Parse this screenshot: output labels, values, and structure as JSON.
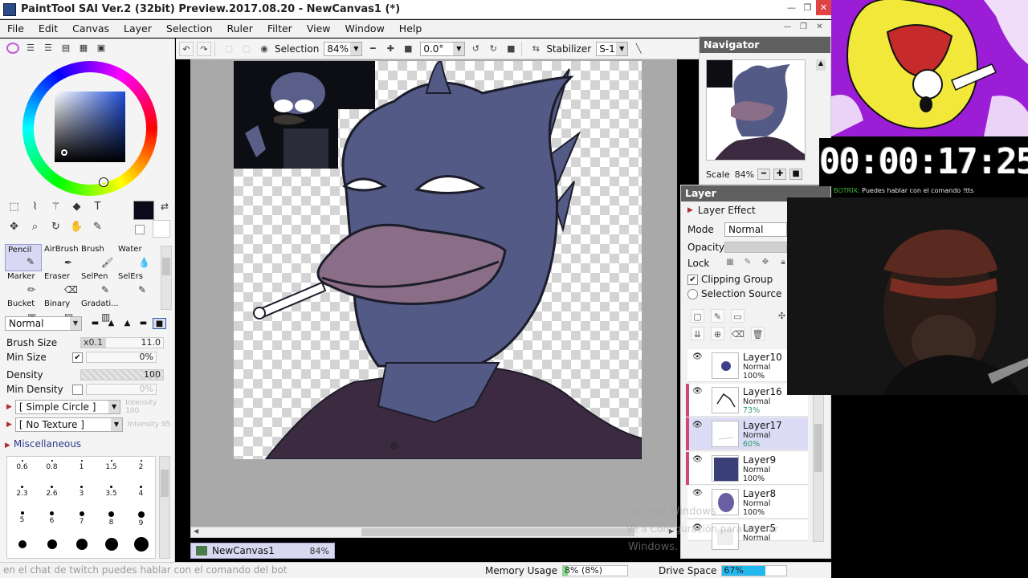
{
  "window": {
    "title": "PaintTool SAI Ver.2 (32bit) Preview.2017.08.20 - NewCanvas1 (*)"
  },
  "menu": [
    "File",
    "Edit",
    "Canvas",
    "Layer",
    "Selection",
    "Ruler",
    "Filter",
    "View",
    "Window",
    "Help"
  ],
  "toolbar": {
    "selection_label": "Selection",
    "zoom": "84%",
    "rotation": "0.0°",
    "stabilizer_label": "Stabilizer",
    "stabilizer_value": "S-1"
  },
  "tools": {
    "brushes": [
      {
        "label": "Pencil",
        "active": true
      },
      {
        "label": "AirBrush"
      },
      {
        "label": "Brush"
      },
      {
        "label": "Water"
      },
      {
        "label": "Marker"
      },
      {
        "label": "Eraser"
      },
      {
        "label": "SelPen"
      },
      {
        "label": "SelErs"
      },
      {
        "label": "Bucket"
      },
      {
        "label": "Binary"
      },
      {
        "label": "Gradati..."
      }
    ],
    "blend_mode": "Normal",
    "brush_size_label": "Brush Size",
    "brush_size_multiplier": "x0.1",
    "brush_size_value": "11.0",
    "min_size_label": "Min Size",
    "min_size_value": "0%",
    "density_label": "Density",
    "density_value": "100",
    "min_density_label": "Min Density",
    "min_density_value": "0%",
    "shape_select": "[ Simple Circle ]",
    "shape_intensity": "Intensity 100",
    "texture_select": "[ No Texture ]",
    "texture_intensity": "Intensity 95",
    "misc_label": "Miscellaneous",
    "brush_sizes": [
      "0.6",
      "0.8",
      "1",
      "1.5",
      "2",
      "2.3",
      "2.6",
      "3",
      "3.5",
      "4",
      "5",
      "6",
      "7",
      "8",
      "9",
      "",
      "",
      "",
      "",
      ""
    ]
  },
  "navigator": {
    "title": "Navigator",
    "scale_label": "Scale",
    "scale_value": "84%"
  },
  "layer_panel": {
    "title": "Layer",
    "layer_effect": "Layer Effect",
    "mode_label": "Mode",
    "mode_value": "Normal",
    "opacity_label": "Opacity",
    "lock_label": "Lock",
    "clipping_group": "Clipping Group",
    "selection_source": "Selection Source",
    "layers": [
      {
        "name": "Layer10",
        "mode": "Normal",
        "opacity": "100%",
        "selected": false,
        "clip": false
      },
      {
        "name": "Layer16",
        "mode": "Normal",
        "opacity": "73%",
        "selected": false,
        "clip": true
      },
      {
        "name": "Layer17",
        "mode": "Normal",
        "opacity": "60%",
        "selected": true,
        "clip": true
      },
      {
        "name": "Layer9",
        "mode": "Normal",
        "opacity": "100%",
        "selected": false,
        "clip": true
      },
      {
        "name": "Layer8",
        "mode": "Normal",
        "opacity": "100%",
        "selected": false,
        "clip": false
      },
      {
        "name": "Layer5",
        "mode": "Normal",
        "opacity": "",
        "selected": false,
        "clip": false
      }
    ]
  },
  "document_tab": {
    "name": "NewCanvas1",
    "zoom": "84%"
  },
  "status": {
    "memory_label": "Memory Usage",
    "memory_value": "8% (8%)",
    "memory_fraction": 0.08,
    "drive_label": "Drive Space",
    "drive_value": "67%",
    "drive_fraction": 0.67,
    "ticker": "en el chat de twitch puedes hablar con el comando del bot"
  },
  "stream": {
    "timer": "00:00:17:25",
    "chat_user": "BOTRIX:",
    "chat_msg": "Puedes hablar con el comando !tts"
  },
  "watermark": {
    "line1": "Activar Windows",
    "line2": "Ve a Configuración para activar",
    "line3": "Windows."
  },
  "colors": {
    "primary": "#0a0a1a",
    "accent_clip": "#d04478",
    "drive_fill": "#22b8f0",
    "memory_fill": "#7ee07e"
  }
}
